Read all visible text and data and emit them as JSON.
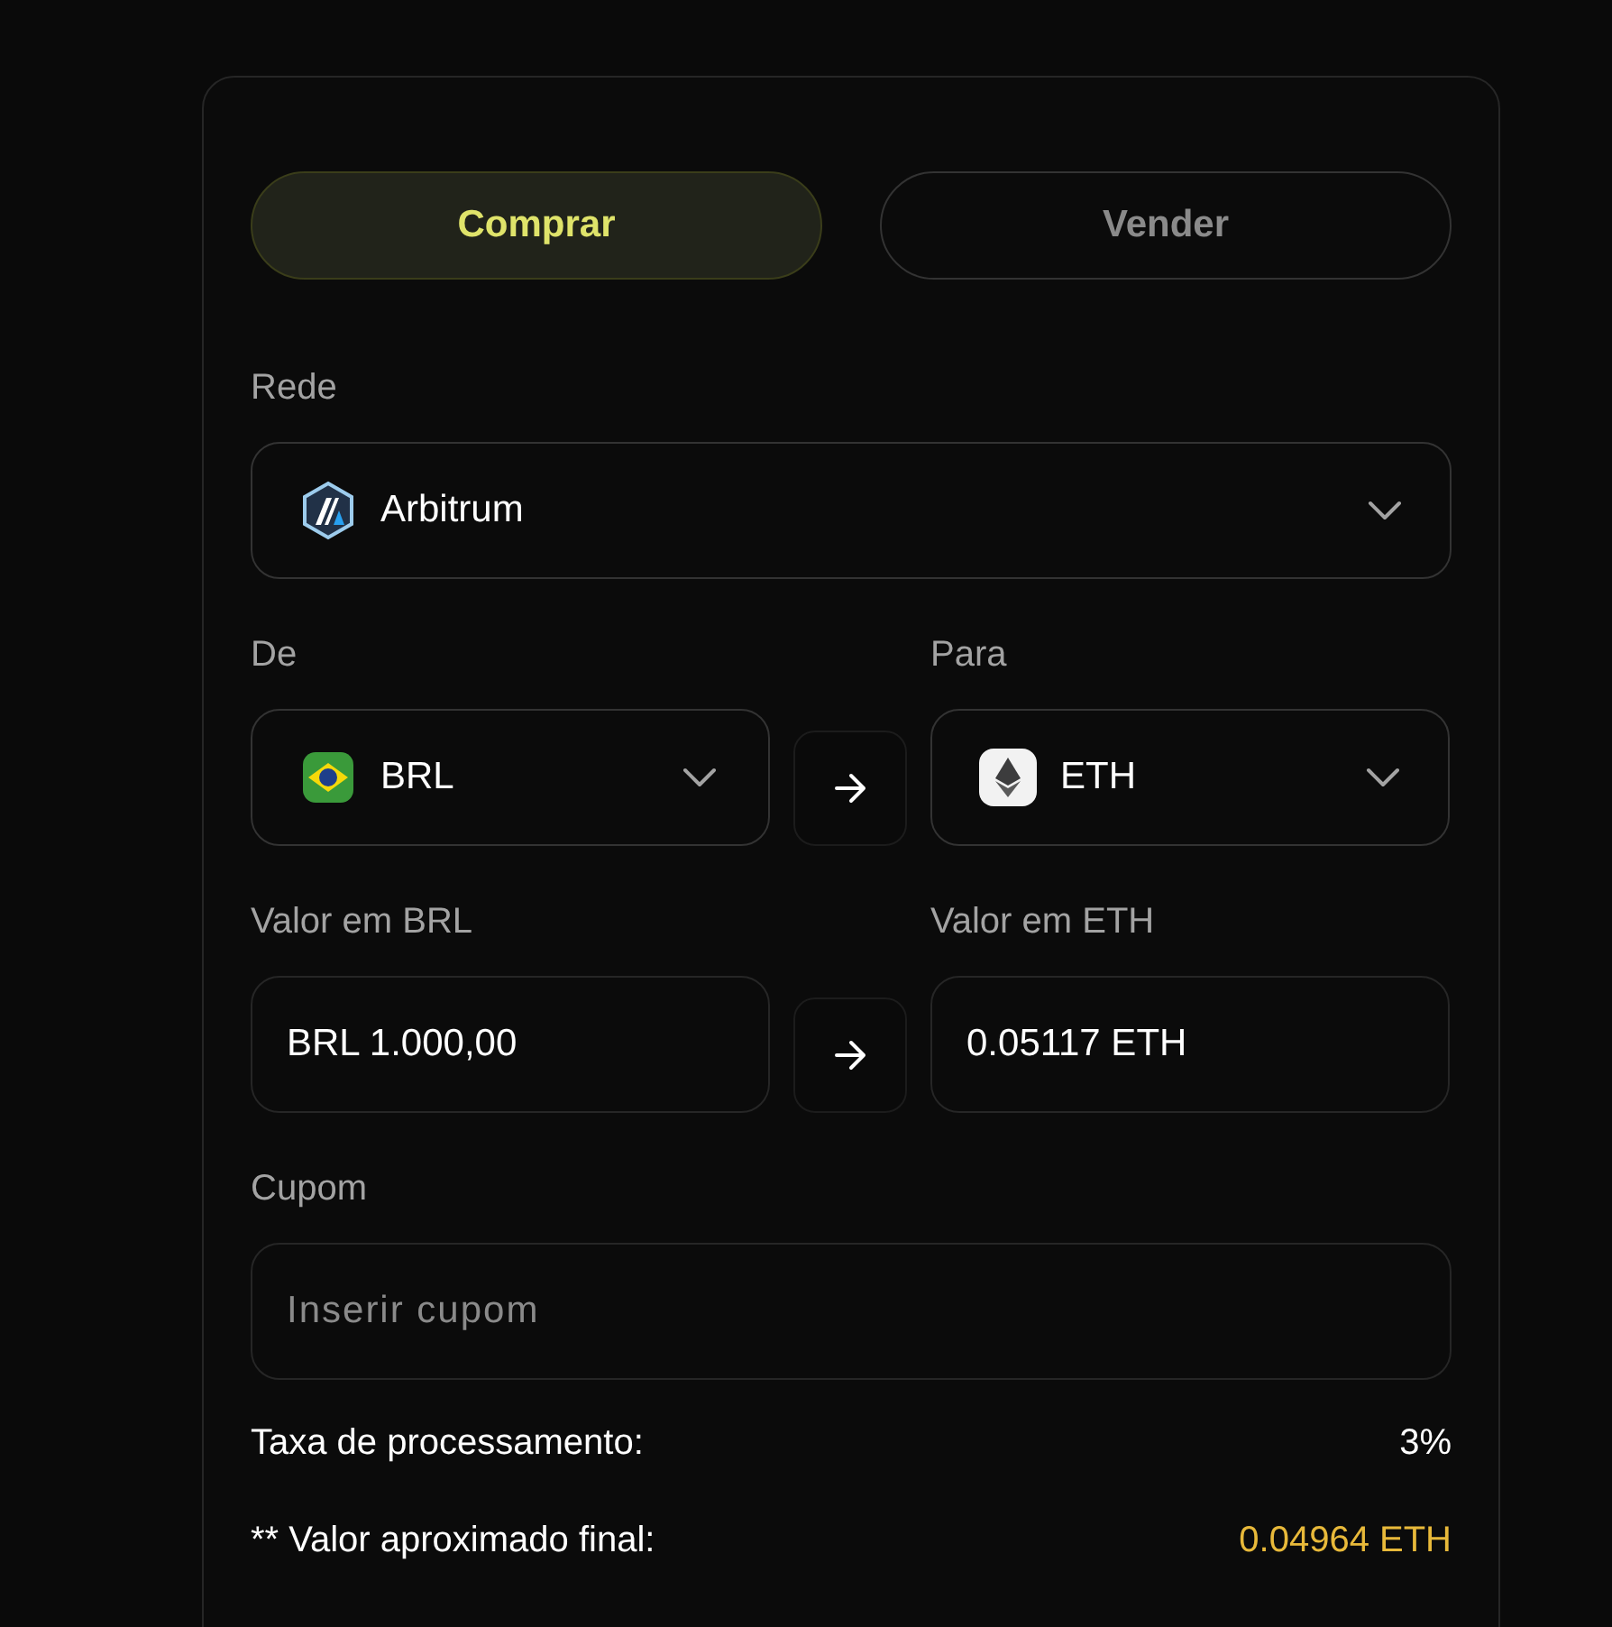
{
  "tabs": [
    {
      "label": "Comprar",
      "selected": true
    },
    {
      "label": "Vender",
      "selected": false
    }
  ],
  "network": {
    "label": "Rede",
    "value": "Arbitrum"
  },
  "from": {
    "label": "De",
    "currency": "BRL"
  },
  "to": {
    "label": "Para",
    "currency": "ETH"
  },
  "amount_from": {
    "label": "Valor em BRL",
    "value": "BRL 1.000,00"
  },
  "amount_to": {
    "label": "Valor em ETH",
    "value": "0.05117 ETH"
  },
  "coupon": {
    "label": "Cupom",
    "placeholder": "Inserir cupom"
  },
  "summary": [
    {
      "label": "Taxa de processamento:",
      "value": "3%",
      "kind": "plain"
    },
    {
      "label": "** Valor aproximado final:",
      "value": "0.04964 ETH",
      "kind": "highlight"
    }
  ]
}
